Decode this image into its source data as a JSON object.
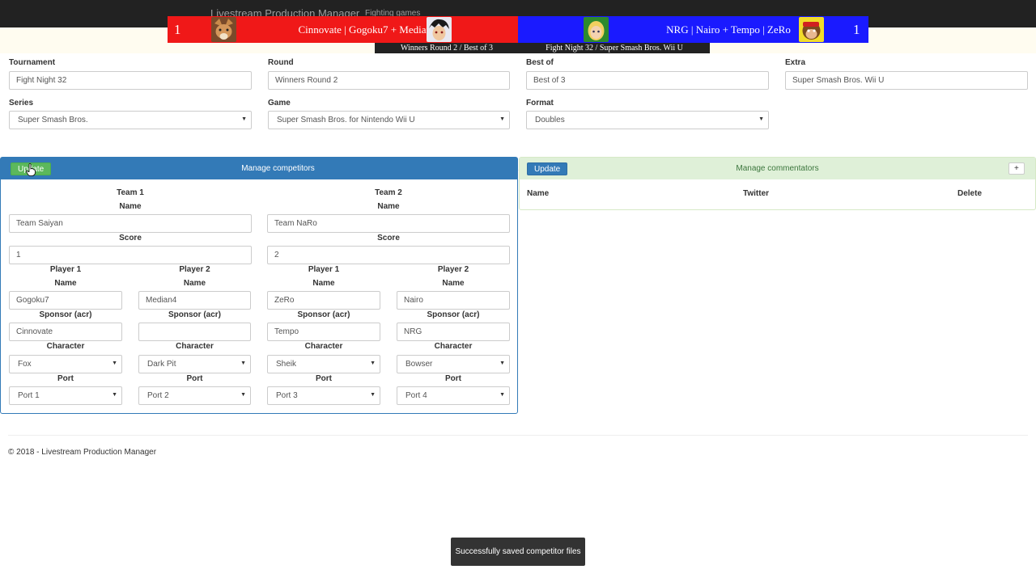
{
  "navbar": {
    "brand": "Livestream Production Manager",
    "link": "Fighting games"
  },
  "scoreboard": {
    "left": {
      "score": "1",
      "label": "Cinnovate | Gogoku7 + Median4",
      "color": "#f01818"
    },
    "right": {
      "score": "1",
      "label": "NRG | Nairo + Tempo | ZeRo",
      "color": "#1a1aff"
    },
    "sub_left": "Winners Round 2 / Best of 3",
    "sub_right": "Fight Night 32 / Super Smash Bros. Wii U"
  },
  "tournament_form": {
    "tournament_label": "Tournament",
    "tournament_value": "Fight Night 32",
    "round_label": "Round",
    "round_value": "Winners Round 2",
    "bestof_label": "Best of",
    "bestof_value": "Best of 3",
    "extra_label": "Extra",
    "extra_value": "Super Smash Bros. Wii U",
    "series_label": "Series",
    "series_value": "Super Smash Bros.",
    "game_label": "Game",
    "game_value": "Super Smash Bros. for Nintendo Wii U",
    "format_label": "Format",
    "format_value": "Doubles"
  },
  "competitors": {
    "update_label": "Update",
    "title": "Manage competitors",
    "name_label": "Name",
    "score_label": "Score",
    "sponsor_label": "Sponsor (acr)",
    "character_label": "Character",
    "port_label": "Port",
    "team1": {
      "heading": "Team 1",
      "name": "Team Saiyan",
      "score": "1",
      "p1": {
        "heading": "Player 1",
        "name": "Gogoku7",
        "sponsor": "Cinnovate",
        "character": "Fox",
        "port": "Port 1"
      },
      "p2": {
        "heading": "Player 2",
        "name": "Median4",
        "sponsor": "",
        "character": "Dark Pit",
        "port": "Port 2"
      }
    },
    "team2": {
      "heading": "Team 2",
      "name": "Team NaRo",
      "score": "2",
      "p1": {
        "heading": "Player 1",
        "name": "ZeRo",
        "sponsor": "Tempo",
        "character": "Sheik",
        "port": "Port 3"
      },
      "p2": {
        "heading": "Player 2",
        "name": "Nairo",
        "sponsor": "NRG",
        "character": "Bowser",
        "port": "Port 4"
      }
    }
  },
  "commentators": {
    "update_label": "Update",
    "title": "Manage commentators",
    "add_label": "+",
    "columns": [
      "Name",
      "Twitter",
      "Delete"
    ]
  },
  "footer": "© 2018 - Livestream Production Manager",
  "toast": "Successfully saved competitor files",
  "icons": {
    "select_caret": "▼"
  }
}
